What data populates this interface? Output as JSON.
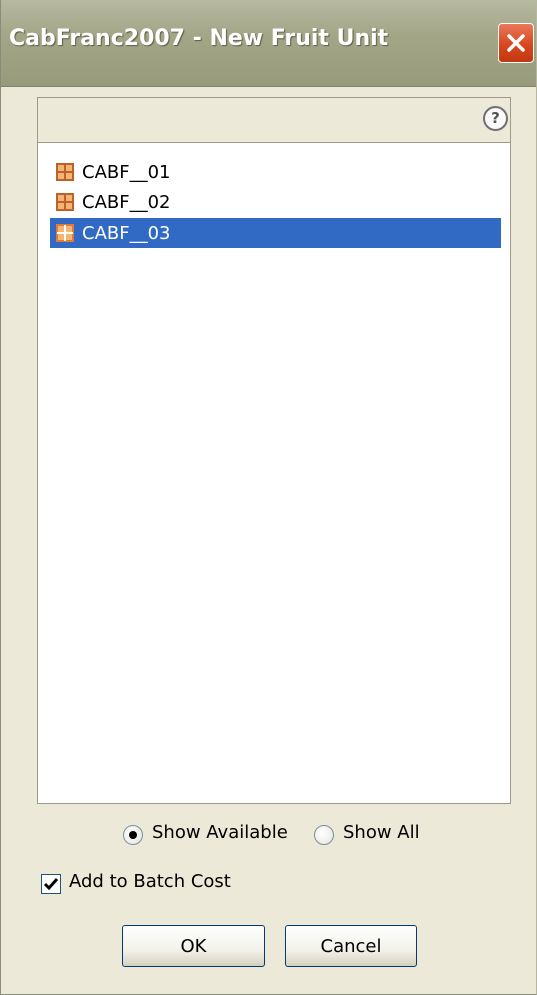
{
  "window": {
    "title": "CabFranc2007 - New Fruit Unit"
  },
  "help": {
    "glyph": "?"
  },
  "list": {
    "items": [
      {
        "label": "CABF__01",
        "selected": false
      },
      {
        "label": "CABF__02",
        "selected": false
      },
      {
        "label": "CABF__03",
        "selected": true
      }
    ]
  },
  "filter": {
    "show_available_label": "Show Available",
    "show_all_label": "Show All",
    "selected": "show_available"
  },
  "options": {
    "add_to_batch_cost_label": "Add to Batch Cost",
    "add_to_batch_cost_checked": true
  },
  "buttons": {
    "ok_label": "OK",
    "cancel_label": "Cancel"
  },
  "colors": {
    "selection": "#316ac5",
    "titlebar": "#a3a687",
    "close": "#d9471f",
    "dialog_bg": "#ece9d8",
    "icon_brown": "#c0612b",
    "icon_orange": "#f3b574"
  }
}
